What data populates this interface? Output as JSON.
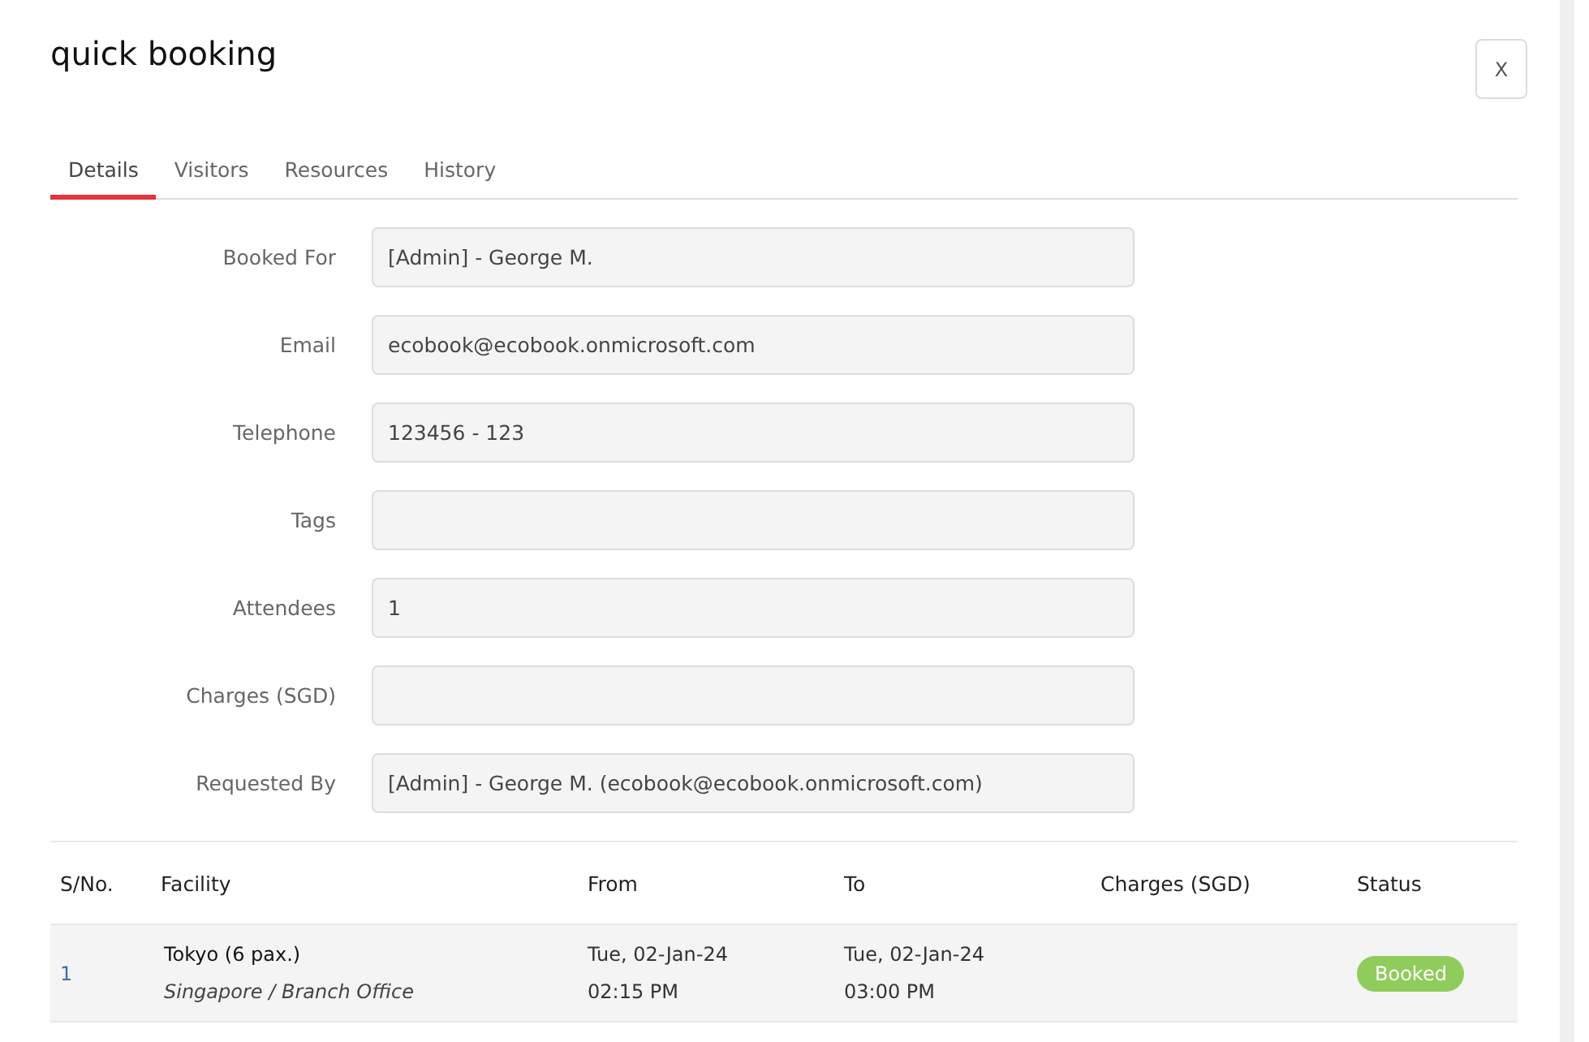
{
  "dialog": {
    "title": "quick booking",
    "close_label": "X"
  },
  "tabs": [
    {
      "label": "Details",
      "selected": true
    },
    {
      "label": "Visitors",
      "selected": false
    },
    {
      "label": "Resources",
      "selected": false
    },
    {
      "label": "History",
      "selected": false
    }
  ],
  "form": [
    {
      "label": "Booked For",
      "value": "[Admin] - George M."
    },
    {
      "label": "Email",
      "value": "ecobook@ecobook.onmicrosoft.com"
    },
    {
      "label": "Telephone",
      "value": "123456 - 123"
    },
    {
      "label": "Tags"
    },
    {
      "label": "Attendees",
      "value": "1"
    },
    {
      "label": "Charges (SGD)"
    },
    {
      "label": "Requested By",
      "value": "[Admin] - George M. (ecobook@ecobook.onmicrosoft.com)"
    }
  ],
  "table": {
    "columns": [
      "S/No.",
      "Facility",
      "From",
      "To",
      "Charges (SGD)",
      "Status"
    ],
    "rows": [
      {
        "sno": "1",
        "facility": "Tokyo (6 pax.)",
        "location": "Singapore / Branch Office",
        "from_date": "Tue, 02-Jan-24",
        "from_time": "02:15 PM",
        "to_date": "Tue, 02-Jan-24",
        "to_time": "03:00 PM",
        "status": "Booked"
      }
    ]
  }
}
